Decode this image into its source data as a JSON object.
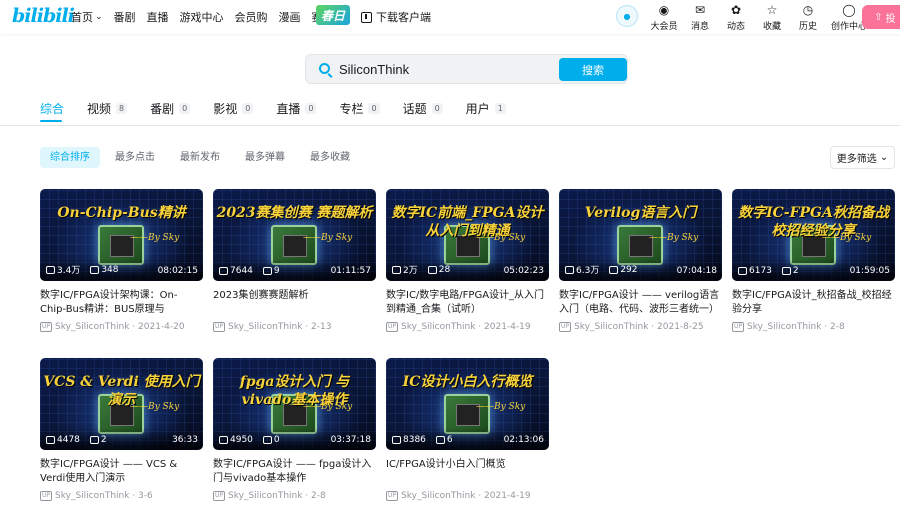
{
  "header": {
    "logo": "bilibili",
    "nav": [
      {
        "label": "首页",
        "has_chevron": true
      },
      {
        "label": "番剧"
      },
      {
        "label": "直播"
      },
      {
        "label": "游戏中心"
      },
      {
        "label": "会员购"
      },
      {
        "label": "漫画"
      },
      {
        "label": "赛事"
      }
    ],
    "spring_badge": "春日",
    "download": "下载客户端",
    "user_actions": [
      {
        "label": "大会员",
        "icon": "vip-icon"
      },
      {
        "label": "消息",
        "icon": "message-icon"
      },
      {
        "label": "动态",
        "icon": "dynamic-icon"
      },
      {
        "label": "收藏",
        "icon": "star-icon"
      },
      {
        "label": "历史",
        "icon": "clock-icon"
      },
      {
        "label": "创作中心",
        "icon": "bulb-icon"
      }
    ],
    "upload": "投"
  },
  "search": {
    "value": "SiliconThink",
    "button": "搜索"
  },
  "tabs": [
    {
      "label": "综合",
      "count": ""
    },
    {
      "label": "视频",
      "count": "8"
    },
    {
      "label": "番剧",
      "count": "0"
    },
    {
      "label": "影视",
      "count": "0"
    },
    {
      "label": "直播",
      "count": "0"
    },
    {
      "label": "专栏",
      "count": "0"
    },
    {
      "label": "话题",
      "count": "0"
    },
    {
      "label": "用户",
      "count": "1"
    }
  ],
  "sort": [
    "综合排序",
    "最多点击",
    "最新发布",
    "最多弹幕",
    "最多收藏"
  ],
  "filter": "更多筛选",
  "videos": [
    {
      "thumb_title": "On-Chip-Bus精讲",
      "thumb_sub": "——By Sky",
      "views": "3.4万",
      "danmaku": "348",
      "duration": "08:02:15",
      "title": "数字IC/FPGA设计架构课：On-Chip-Bus精讲：BUS原理与DDR/Cach...",
      "author": "Sky_SiliconThink",
      "date": "2021-4-20"
    },
    {
      "thumb_title": "2023赛集创赛 赛题解析",
      "thumb_sub": "——By Sky",
      "views": "7644",
      "danmaku": "9",
      "duration": "01:11:57",
      "title": "2023集创赛赛题解析",
      "author": "Sky_SiliconThink",
      "date": "2-13"
    },
    {
      "thumb_title": "数字IC前端_FPGA设计 从入门到精通",
      "thumb_sub": "——By Sky",
      "views": "2万",
      "danmaku": "28",
      "duration": "05:02:23",
      "title": "数字IC/数字电路/FPGA设计_从入门到精通_合集（试听）",
      "author": "Sky_SiliconThink",
      "date": "2021-4-19"
    },
    {
      "thumb_title": "Verilog语言入门",
      "thumb_sub": "——By Sky",
      "views": "6.3万",
      "danmaku": "292",
      "duration": "07:04:18",
      "title": "数字IC/FPGA设计 —— verilog语言入门（电路、代码、波形三者统一）",
      "author": "Sky_SiliconThink",
      "date": "2021-8-25"
    },
    {
      "thumb_title": "数字IC-FPGA秋招备战 校招经验分享",
      "thumb_sub": "——By Sky",
      "views": "6173",
      "danmaku": "2",
      "duration": "01:59:05",
      "title": "数字IC/FPGA设计_秋招备战_校招经验分享",
      "author": "Sky_SiliconThink",
      "date": "2-8"
    },
    {
      "thumb_title": "VCS & Verdi 使用入门演示",
      "thumb_sub": "——By Sky",
      "views": "4478",
      "danmaku": "2",
      "duration": "36:33",
      "title": "数字IC/FPGA设计 —— VCS & Verdi使用入门演示",
      "author": "Sky_SiliconThink",
      "date": "3-6"
    },
    {
      "thumb_title": "fpga设计入门 与 vivado基本操作",
      "thumb_sub": "——By Sky",
      "views": "4950",
      "danmaku": "0",
      "duration": "03:37:18",
      "title": "数字IC/FPGA设计 —— fpga设计入门与vivado基本操作",
      "author": "Sky_SiliconThink",
      "date": "2-8"
    },
    {
      "thumb_title": "IC设计小白入行概览",
      "thumb_sub": "——By Sky",
      "views": "8386",
      "danmaku": "6",
      "duration": "02:13:06",
      "title": "IC/FPGA设计小白入门概览",
      "author": "Sky_SiliconThink",
      "date": "2021-4-19"
    }
  ]
}
